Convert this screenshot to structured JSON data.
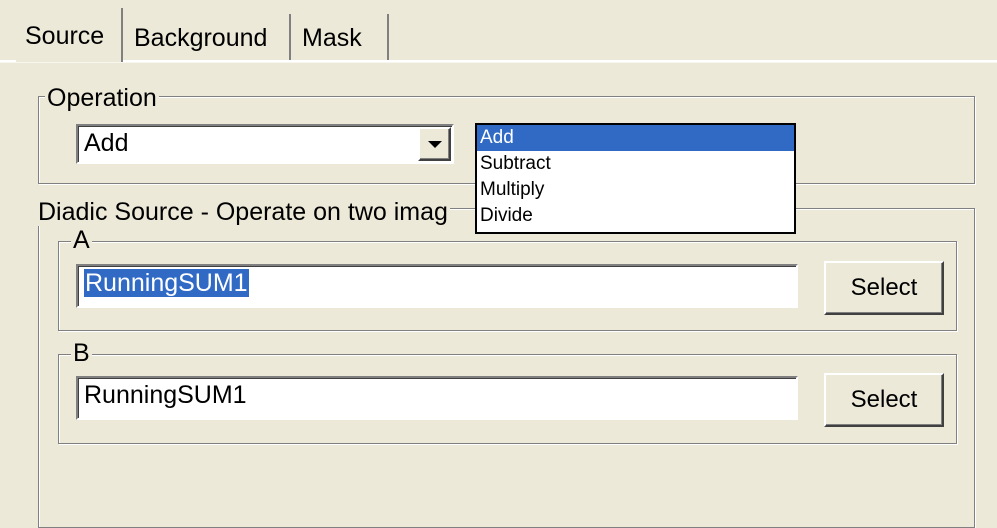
{
  "tabs": [
    {
      "label": "Source",
      "active": true
    },
    {
      "label": "Background",
      "active": false
    },
    {
      "label": "Mask",
      "active": false
    }
  ],
  "operation": {
    "legend": "Operation",
    "value": "Add",
    "options": [
      "Add",
      "Subtract",
      "Multiply",
      "Divide"
    ],
    "highlighted_option": "Add"
  },
  "diadic": {
    "legend": "Diadic Source - Operate on two imag",
    "a": {
      "legend": "A",
      "value": "RunningSUM1",
      "button": "Select"
    },
    "b": {
      "legend": "B",
      "value": "RunningSUM1",
      "button": "Select"
    }
  },
  "colors": {
    "face": "#ece9d8",
    "highlight": "#316ac5"
  },
  "icons": {
    "dropdown_arrow": "chevron-down-icon"
  }
}
